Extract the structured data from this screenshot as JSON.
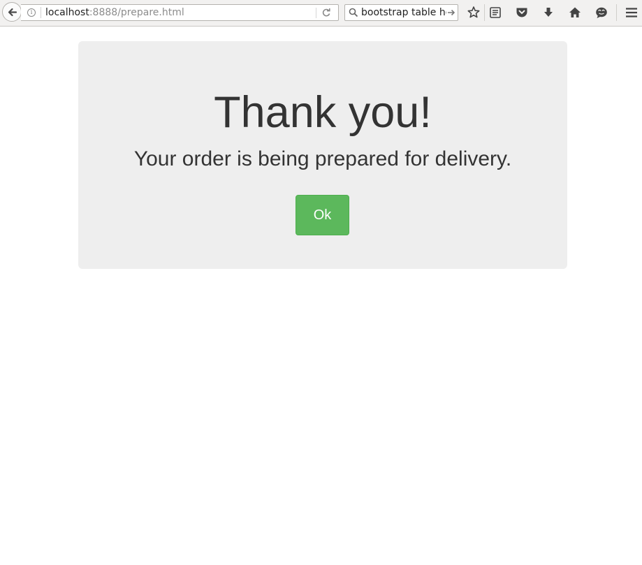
{
  "browser": {
    "url_host": "localhost",
    "url_rest": ":8888/prepare.html",
    "search_value": "bootstrap table he"
  },
  "toolbar_icons": [
    "back-arrow-icon",
    "info-icon",
    "reload-icon",
    "search-icon",
    "search-go-arrow-icon",
    "bookmark-star-icon",
    "reading-list-icon",
    "pocket-icon",
    "download-icon",
    "home-icon",
    "chat-icon",
    "hamburger-menu-icon"
  ],
  "page": {
    "title": "Thank you!",
    "subtitle": "Your order is being prepared for delivery.",
    "ok_label": "Ok"
  },
  "colors": {
    "jumbotron_bg": "#eeeeee",
    "text": "#333333",
    "success_button": "#5cb85c"
  }
}
